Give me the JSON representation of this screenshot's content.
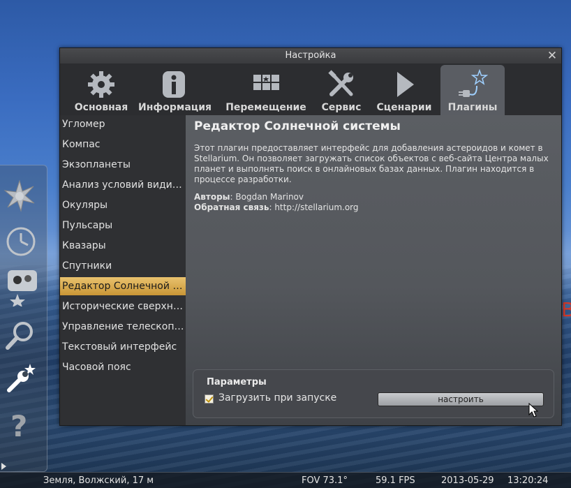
{
  "dialog": {
    "title": "Настройка",
    "tabs": [
      {
        "label": "Основная",
        "icon": "gear-icon"
      },
      {
        "label": "Информация",
        "icon": "info-icon"
      },
      {
        "label": "Перемещение",
        "icon": "navigation-icon"
      },
      {
        "label": "Сервис",
        "icon": "tools-icon"
      },
      {
        "label": "Сценарии",
        "icon": "play-icon"
      },
      {
        "label": "Плагины",
        "icon": "plugin-icon"
      }
    ],
    "plugins": [
      "Угломер",
      "Компас",
      "Экзопланеты",
      "Анализ условий видимости",
      "Окуляры",
      "Пульсары",
      "Квазары",
      "Спутники",
      "Редактор Солнечной системы",
      "Исторические сверхновые",
      "Управление телескопом",
      "Текстовый интерфейс",
      "Часовой пояс"
    ],
    "selected_plugin_index": 8,
    "content": {
      "title": "Редактор Солнечной системы",
      "description": "Этот плагин предоставляет интерфейс для добавления астероидов и комет в Stellarium. Он позволяет загружать список объектов с веб-сайта Центра малых планет и выполнять поиск в онлайновых базах данных. Плагин находится в процессе разработки.",
      "authors_label": "Авторы",
      "authors": "Bogdan Marinov",
      "feedback_label": "Обратная связь",
      "feedback": "http://stellarium.org"
    },
    "params": {
      "title": "Параметры",
      "load_at_startup_label": "Загрузить при запуске",
      "load_at_startup_checked": true,
      "configure_label": "настроить"
    }
  },
  "statusbar": {
    "location": "Земля, Волжский, 17 м",
    "fov": "FOV 73.1°",
    "fps": "59.1 FPS",
    "date": "2013-05-29",
    "time": "13:20:24"
  },
  "background": {
    "corner_letter": "В"
  },
  "left_toolbar": [
    "sky-culture-icon",
    "clock-icon",
    "sky-view-icon",
    "search-icon",
    "config-wrench-icon",
    "help-icon"
  ]
}
